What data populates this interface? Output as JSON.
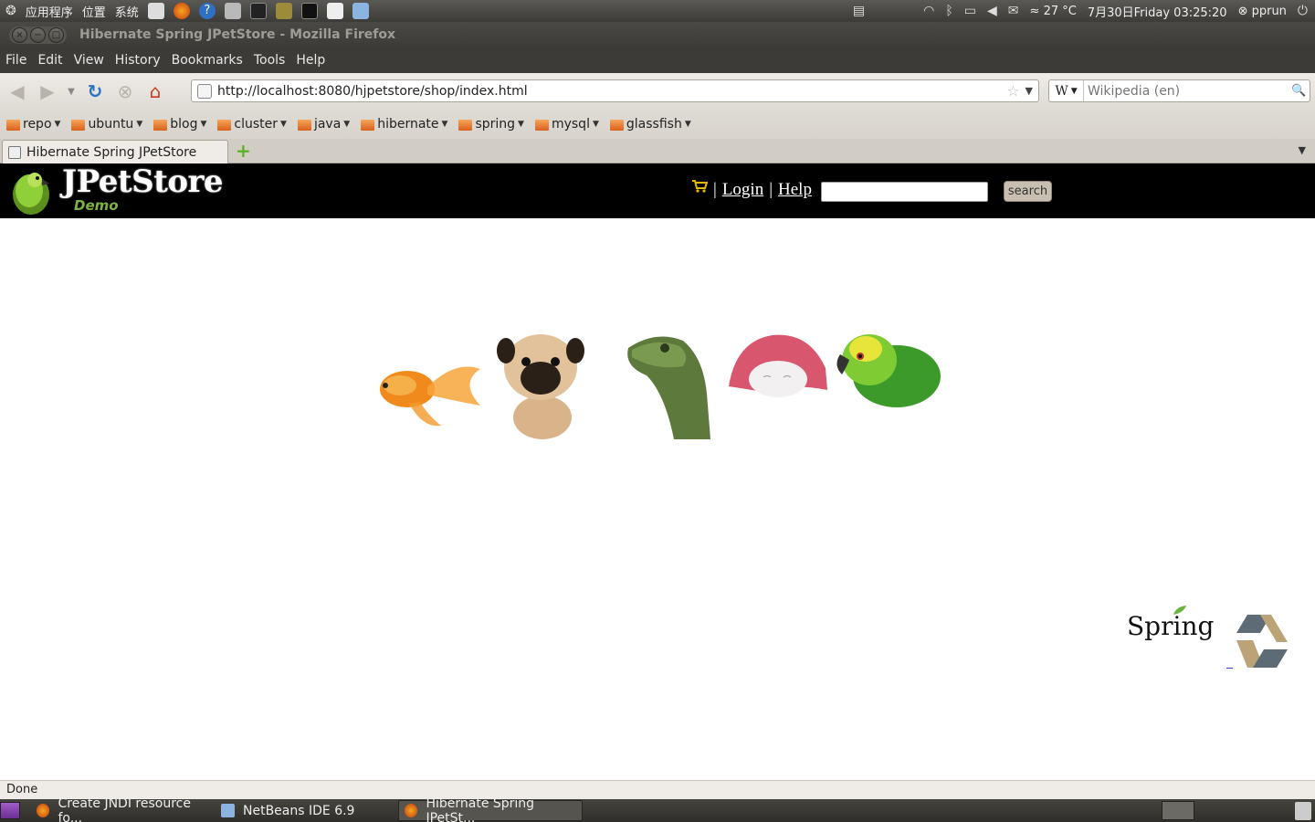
{
  "top_panel": {
    "menus": [
      "应用程序",
      "位置",
      "系统"
    ],
    "weather": "27 °C",
    "clock": "7月30日Friday 03:25:20",
    "user": "pprun"
  },
  "window": {
    "title": "Hibernate Spring JPetStore - Mozilla Firefox"
  },
  "menubar": {
    "items": [
      "File",
      "Edit",
      "View",
      "History",
      "Bookmarks",
      "Tools",
      "Help"
    ]
  },
  "navbar": {
    "url": "http://localhost:8080/hjpetstore/shop/index.html",
    "search_engine_letter": "W",
    "search_placeholder": "Wikipedia (en)"
  },
  "bookmarks": {
    "folders": [
      "repo",
      "ubuntu",
      "blog",
      "cluster",
      "java",
      "hibernate",
      "spring",
      "mysql",
      "glassfish"
    ]
  },
  "tabs": {
    "active_title": "Hibernate Spring JPetStore"
  },
  "page": {
    "logo_text": "JPetStore",
    "logo_subtext": "Demo",
    "menu": {
      "login": "Login",
      "help": "Help",
      "sep": "|"
    },
    "search_button": "search",
    "spring_logo": "Spring"
  },
  "statusbar": {
    "text": "Done"
  },
  "taskbar": {
    "tasks": [
      "Create JNDI resource fo...",
      "NetBeans IDE 6.9",
      "Hibernate Spring JPetSt..."
    ]
  },
  "colors": {
    "panel": "#3c3b37",
    "header_bg": "#000000",
    "demo_green": "#7cb342",
    "firefox_orange": "#e66000"
  }
}
